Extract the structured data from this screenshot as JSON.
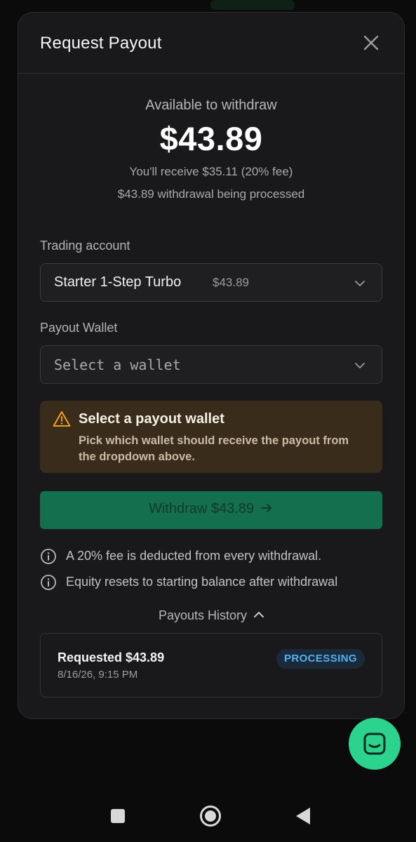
{
  "modal": {
    "title": "Request Payout"
  },
  "summary": {
    "available_label": "Available to withdraw",
    "amount": "$43.89",
    "receive_line": "You'll receive $35.11 (20% fee)",
    "processing_line": "$43.89 withdrawal being processed"
  },
  "trading_account": {
    "label": "Trading account",
    "selected_name": "Starter 1-Step Turbo",
    "selected_balance": "$43.89"
  },
  "payout_wallet": {
    "label": "Payout Wallet",
    "placeholder": "Select a wallet"
  },
  "alert": {
    "title": "Select a payout wallet",
    "body": "Pick which wallet should receive the payout from the dropdown above.",
    "color": "#f0a020"
  },
  "withdraw_button": {
    "label": "Withdraw $43.89"
  },
  "info": [
    "A 20% fee is deducted from every withdrawal.",
    "Equity resets to starting balance after withdrawal"
  ],
  "history": {
    "toggle_label": "Payouts History",
    "items": [
      {
        "amount": "Requested $43.89",
        "date": "8/16/26, 9:15 PM",
        "status": "PROCESSING"
      }
    ]
  },
  "colors": {
    "accent_green": "#136f4e",
    "fab_green": "#2bd38f",
    "status_blue": "#4fb3f0"
  }
}
